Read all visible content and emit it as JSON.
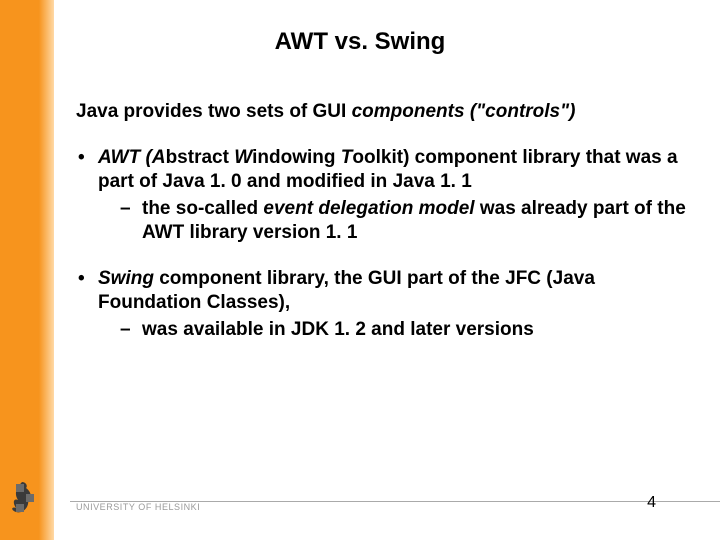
{
  "title": "AWT vs. Swing",
  "lead": {
    "prefix": "Java provides two sets of GUI ",
    "em": "components (\"controls\")"
  },
  "bullets": [
    {
      "segments": [
        {
          "t": "AWT (",
          "i": true
        },
        {
          "t": "A",
          "i": true
        },
        {
          "t": "bstract ",
          "i": false
        },
        {
          "t": "W",
          "i": true
        },
        {
          "t": "indowing ",
          "i": false
        },
        {
          "t": "T",
          "i": true
        },
        {
          "t": "oolkit) component library that was a part of Java 1. 0 and modified in Java 1. 1",
          "i": false
        }
      ],
      "sub": [
        {
          "segments": [
            {
              "t": "the so-called ",
              "i": false
            },
            {
              "t": "event delegation model",
              "i": true
            },
            {
              "t": " was already part of the AWT library version 1. 1",
              "i": false
            }
          ]
        }
      ]
    },
    {
      "segments": [
        {
          "t": "Swing",
          "i": true
        },
        {
          "t": " component library, the GUI part of the JFC (Java Foundation Classes),",
          "i": false
        }
      ],
      "sub": [
        {
          "segments": [
            {
              "t": "was available in JDK 1. 2 and later versions",
              "i": false
            }
          ]
        }
      ]
    }
  ],
  "footer": {
    "university": "UNIVERSITY OF HELSINKI",
    "page": "4"
  }
}
